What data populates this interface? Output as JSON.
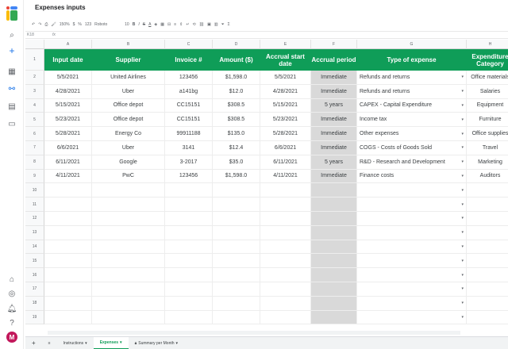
{
  "app": {
    "title": "Expenses inputs"
  },
  "toolbar": {
    "zoom": "150%",
    "currency": "$",
    "percent": "%",
    "format_more": "123",
    "font": "Roboto",
    "font_size": "10",
    "sum": "Σ"
  },
  "formula_bar": {
    "cell_ref": "K18",
    "fx": "fx"
  },
  "columns": [
    "A",
    "B",
    "C",
    "D",
    "E",
    "F",
    "G",
    "H"
  ],
  "headers": [
    "Input date",
    "Supplier",
    "Invoice #",
    "Amount ($)",
    "Accrual start date",
    "Accrual period",
    "Type of expense",
    "Expenditure Category"
  ],
  "rows": [
    [
      "5/5/2021",
      "United Airlines",
      "123456",
      "$1,598.0",
      "5/5/2021",
      "Immediate",
      "Refunds and returns",
      "Office materials"
    ],
    [
      "4/28/2021",
      "Uber",
      "a141bg",
      "$12.0",
      "4/28/2021",
      "Immediate",
      "Refunds and returns",
      "Salaries"
    ],
    [
      "5/15/2021",
      "Office depot",
      "CC15151",
      "$308.5",
      "5/15/2021",
      "5 years",
      "CAPEX - Capital Expenditure",
      "Equipment"
    ],
    [
      "5/23/2021",
      "Office depot",
      "CC15151",
      "$308.5",
      "5/23/2021",
      "Immediate",
      "Income tax",
      "Furniture"
    ],
    [
      "5/28/2021",
      "Energy Co",
      "99911188",
      "$135.0",
      "5/28/2021",
      "Immediate",
      "Other expenses",
      "Office supplies"
    ],
    [
      "6/6/2021",
      "Uber",
      "3141",
      "$12.4",
      "6/6/2021",
      "Immediate",
      "COGS - Costs of Goods Sold",
      "Travel"
    ],
    [
      "6/11/2021",
      "Google",
      "3-2017",
      "$35.0",
      "6/11/2021",
      "5 years",
      "R&D - Research and Development",
      "Marketing"
    ],
    [
      "4/11/2021",
      "PwC",
      "123456",
      "$1,598.0",
      "4/11/2021",
      "Immediate",
      "Finance costs",
      "Auditors"
    ]
  ],
  "row_numbers": [
    "1",
    "2",
    "3",
    "4",
    "5",
    "6",
    "7",
    "8",
    "9",
    "10",
    "11",
    "12",
    "13",
    "14",
    "15",
    "16",
    "17",
    "18",
    "19"
  ],
  "tabs": [
    {
      "label": "Instructions",
      "active": false
    },
    {
      "label": "Expenses",
      "active": true
    },
    {
      "label": "Summary per Month",
      "active": false
    }
  ],
  "user": {
    "avatar_initial": "M"
  },
  "colors": {
    "header_green": "#0f9d58",
    "gray_column": "#d9d9d9"
  }
}
